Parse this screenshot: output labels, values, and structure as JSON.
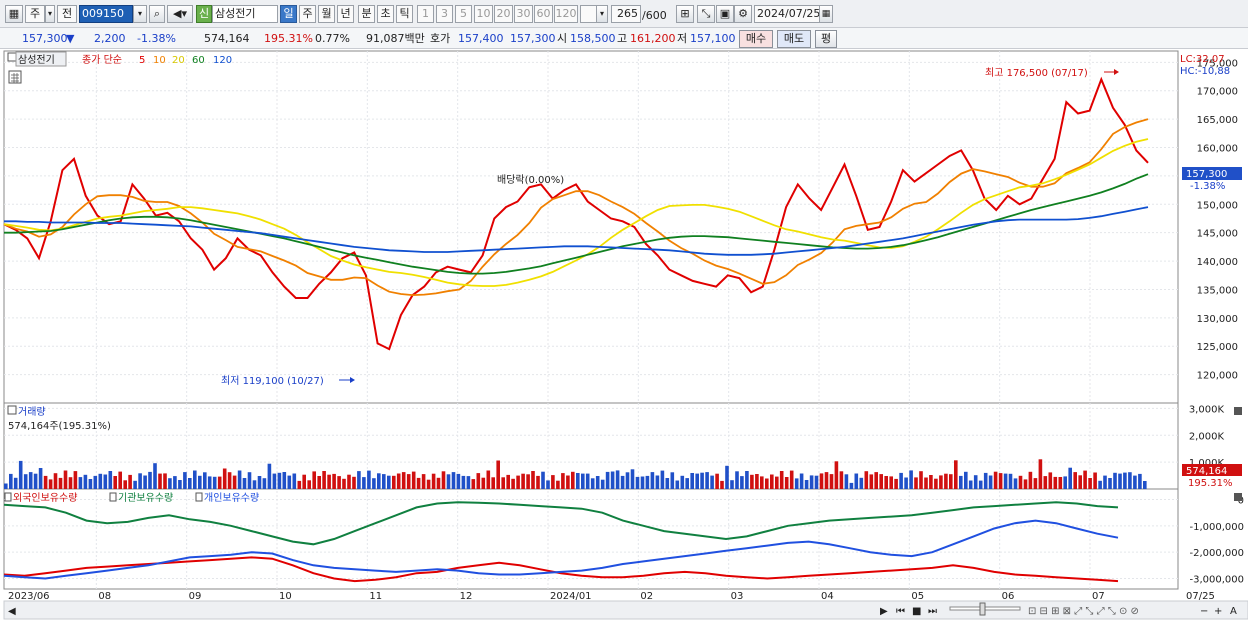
{
  "toolbar": {
    "period_label": "주",
    "prev_label": "전",
    "stock_code": "009150",
    "stock_name": "삼성전기",
    "sin_label": "신",
    "period_buttons": [
      "일",
      "주",
      "월",
      "년",
      "분",
      "초",
      "틱"
    ],
    "interval_buttons": [
      "1",
      "3",
      "5",
      "10",
      "20",
      "30",
      "60",
      "120"
    ],
    "count": "265",
    "count_max": "/600",
    "date": "2024/07/25"
  },
  "quote": {
    "price": "157,300",
    "change": "2,200",
    "change_pct": "-1.38%",
    "volume": "574,164",
    "volume_ratio": "195.31%",
    "turnover_pct": "0.77%",
    "amount": "91,087백만",
    "ask_label": "호가",
    "ask": "157,400",
    "bid": "157,300",
    "open_label": "시",
    "open": "158,500",
    "high_label": "고",
    "high": "161,200",
    "low_label": "저",
    "low": "157,100",
    "buy_label": "매수",
    "sell_label": "매도",
    "eval_label": "평"
  },
  "price_panel": {
    "name": "삼성전기",
    "ma_label": "종가 단순",
    "lc": "LC:32,07",
    "hc": "HC:-10,88",
    "high_annotation": "최고 176,500 (07/17)",
    "low_annotation": "최저 119,100 (10/27)",
    "dividend_annotation": "배당락(0.00%)",
    "current_price": "157,300",
    "current_pct": "-1.38%"
  },
  "volume_panel": {
    "title": "거래량",
    "readout": "574,164주(195.31%)",
    "current": "574,164",
    "current_pct": "195.31%"
  },
  "holdings_panel": {
    "series_labels": [
      "외국인보유수량",
      "기관보유수량",
      "개인보유수량"
    ]
  },
  "chart_data": [
    {
      "type": "candlestick",
      "y_axis_ticks": [
        "175,000",
        "170,000",
        "165,000",
        "160,000",
        "155,000",
        "150,000",
        "145,000",
        "140,000",
        "135,000",
        "130,000",
        "125,000",
        "120,000"
      ],
      "ylim": [
        115000,
        177000
      ],
      "moving_averages": [
        {
          "name": "5",
          "color": "#e00000"
        },
        {
          "name": "10",
          "color": "#f08000"
        },
        {
          "name": "20",
          "color": "#f0e000"
        },
        {
          "name": "60",
          "color": "#108020"
        },
        {
          "name": "120",
          "color": "#1050d0"
        }
      ],
      "series": [
        {
          "name": "5",
          "values": [
            146500,
            145500,
            144000,
            140500,
            147000,
            156000,
            158000,
            151500,
            148000,
            146500,
            147000,
            153500,
            151000,
            148000,
            148500,
            147000,
            144000,
            142000,
            138500,
            140500,
            144000,
            142000,
            141000,
            138000,
            135500,
            133500,
            133500,
            136000,
            138000,
            140500,
            141500,
            137500,
            125500,
            124500,
            130500,
            134000,
            135500,
            138000,
            139000,
            138500,
            138000,
            141000,
            147500,
            149500,
            150500,
            153000,
            153500,
            151000,
            152500,
            153500,
            150500,
            149000,
            147500,
            147000,
            146000,
            143000,
            141000,
            138500,
            137500,
            136500,
            136000,
            135500,
            137500,
            137000,
            134500,
            135500,
            142000,
            149500,
            153500,
            151000,
            149000,
            153000,
            157000,
            151500,
            145500,
            146000,
            150500,
            156000,
            154000,
            155500,
            157000,
            158500,
            159500,
            156000,
            151000,
            149000,
            151500,
            150000,
            151000,
            154500,
            158000,
            168000,
            166000,
            166500,
            172000,
            167000,
            164000,
            159500,
            157300
          ]
        },
        {
          "name": "10",
          "values": [
            146500,
            145700,
            145200,
            144300,
            144700,
            146000,
            148200,
            150000,
            151400,
            151600,
            151600,
            151300,
            150600,
            150400,
            150400,
            149700,
            148400,
            146800,
            144800,
            143700,
            142500,
            142100,
            141700,
            140900,
            140100,
            139200,
            137900,
            137300,
            136700,
            136700,
            137100,
            137000,
            135700,
            134600,
            134200,
            134000,
            134100,
            134300,
            134700,
            135000,
            136500,
            139000,
            141200,
            143000,
            144600,
            146700,
            149400,
            150900,
            151600,
            152300,
            152300,
            151600,
            150500,
            149500,
            148300,
            146700,
            145200,
            143600,
            142300,
            141300,
            140100,
            139200,
            138600,
            137800,
            136900,
            136000,
            136300,
            137500,
            139300,
            140300,
            141400,
            143300,
            145600,
            146200,
            146500,
            146800,
            147700,
            149200,
            150100,
            150400,
            151900,
            153900,
            155400,
            156200,
            155800,
            155300,
            154800,
            153800,
            153100,
            153100,
            153700,
            155500,
            156400,
            157400,
            159700,
            162400,
            163600,
            164400,
            165000
          ]
        },
        {
          "name": "20",
          "values": [
            146500,
            146200,
            145900,
            145500,
            145400,
            145700,
            146300,
            146900,
            147500,
            147800,
            148000,
            148400,
            148800,
            149000,
            149200,
            149500,
            149500,
            149300,
            149000,
            148700,
            148400,
            147900,
            147300,
            146500,
            145700,
            144600,
            143300,
            142100,
            140900,
            140100,
            139400,
            138900,
            138500,
            138100,
            137900,
            137600,
            137200,
            136700,
            136200,
            135900,
            135700,
            135600,
            135600,
            135800,
            136200,
            136700,
            137300,
            138100,
            139100,
            140100,
            141200,
            142500,
            144100,
            145500,
            146700,
            147900,
            149000,
            149700,
            149800,
            149900,
            149900,
            149600,
            149200,
            148700,
            147900,
            147100,
            146300,
            145600,
            145200,
            144700,
            144200,
            143800,
            143600,
            143200,
            142800,
            142400,
            142300,
            142600,
            143400,
            144300,
            145600,
            147000,
            148500,
            149900,
            150900,
            151600,
            152300,
            153000,
            153300,
            153700,
            154400,
            155200,
            156100,
            157000,
            158200,
            159400,
            160300,
            161000,
            161500
          ]
        },
        {
          "name": "60",
          "values": [
            145000,
            145000,
            145100,
            145200,
            145300,
            145600,
            146000,
            146400,
            146800,
            147200,
            147500,
            147700,
            147800,
            147800,
            147700,
            147500,
            147200,
            146800,
            146400,
            146000,
            145600,
            145200,
            144800,
            144400,
            144000,
            143500,
            143000,
            142500,
            142000,
            141500,
            141000,
            140600,
            140200,
            139800,
            139400,
            139000,
            138700,
            138400,
            138100,
            137900,
            137800,
            137800,
            137900,
            138100,
            138400,
            138700,
            139100,
            139600,
            140100,
            140600,
            141100,
            141600,
            142100,
            142600,
            143000,
            143400,
            143800,
            144100,
            144300,
            144400,
            144400,
            144300,
            144200,
            144000,
            143800,
            143600,
            143400,
            143200,
            143000,
            142800,
            142600,
            142400,
            142300,
            142200,
            142200,
            142300,
            142500,
            142800,
            143200,
            143700,
            144200,
            144800,
            145400,
            146000,
            146600,
            147200,
            147800,
            148400,
            149000,
            149500,
            150000,
            150500,
            151000,
            151500,
            152100,
            152800,
            153600,
            154500,
            155300
          ]
        },
        {
          "name": "120",
          "values": [
            147000,
            147000,
            146900,
            146900,
            146800,
            146800,
            146800,
            146800,
            146700,
            146700,
            146700,
            146600,
            146500,
            146400,
            146300,
            146200,
            146100,
            145900,
            145700,
            145500,
            145300,
            145100,
            144900,
            144600,
            144300,
            144000,
            143700,
            143400,
            143100,
            142800,
            142500,
            142300,
            142100,
            141900,
            141800,
            141700,
            141600,
            141600,
            141600,
            141700,
            141800,
            141900,
            142000,
            142100,
            142200,
            142300,
            142400,
            142500,
            142600,
            142600,
            142600,
            142500,
            142400,
            142300,
            142200,
            142100,
            142000,
            141900,
            141700,
            141500,
            141300,
            141200,
            141100,
            141100,
            141100,
            141200,
            141300,
            141500,
            141700,
            141900,
            142100,
            142300,
            142500,
            142800,
            143100,
            143400,
            143700,
            144000,
            144400,
            144800,
            145200,
            145600,
            146000,
            146400,
            146700,
            147000,
            147200,
            147300,
            147300,
            147300,
            147300,
            147300,
            147400,
            147600,
            147900,
            148300,
            148700,
            149100,
            149500
          ]
        }
      ]
    },
    {
      "type": "bar",
      "name": "거래량",
      "y_axis_ticks": [
        "3,000K",
        "2,000K",
        "1,000K"
      ],
      "ylim": [
        0,
        3200000
      ]
    },
    {
      "type": "line",
      "y_axis_ticks": [
        "0",
        "-1,000,000",
        "-2,000,000",
        "-3,000,000"
      ],
      "ylim": [
        -3400000,
        400000
      ],
      "x_labels": [
        "2023/06",
        "08",
        "09",
        "10",
        "11",
        "12",
        "2024/01",
        "02",
        "03",
        "04",
        "05",
        "06",
        "07",
        "07/25"
      ],
      "series": [
        {
          "name": "외국인보유수량",
          "color": "#e00000",
          "values": [
            -2850000,
            -2900000,
            -2800000,
            -2700000,
            -2600000,
            -2550000,
            -2500000,
            -2450000,
            -2400000,
            -2350000,
            -2300000,
            -2250000,
            -2200000,
            -2250000,
            -2500000,
            -2800000,
            -3000000,
            -3100000,
            -3050000,
            -2950000,
            -2800000,
            -2750000,
            -2600000,
            -2500000,
            -2400000,
            -2500000,
            -2650000,
            -2800000,
            -2900000,
            -2950000,
            -2950000,
            -2900000,
            -2800000,
            -2750000,
            -2800000,
            -2900000,
            -2950000,
            -3000000,
            -2950000,
            -2900000,
            -2850000,
            -2800000,
            -2750000,
            -2700000,
            -2650000,
            -2600000,
            -2500000,
            -2600000,
            -2750000,
            -2850000,
            -2900000,
            -2950000,
            -3000000,
            -3050000,
            -3100000
          ]
        },
        {
          "name": "기관보유수량",
          "color": "#108040",
          "values": [
            -200000,
            -250000,
            -300000,
            -500000,
            -800000,
            -900000,
            -850000,
            -700000,
            -600000,
            -750000,
            -850000,
            -1000000,
            -1200000,
            -1400000,
            -1600000,
            -1700000,
            -1500000,
            -1200000,
            -900000,
            -600000,
            -300000,
            -150000,
            -100000,
            -120000,
            -150000,
            -200000,
            -250000,
            -300000,
            -350000,
            -500000,
            -800000,
            -1000000,
            -1200000,
            -1300000,
            -1400000,
            -1500000,
            -1400000,
            -1200000,
            -1000000,
            -900000,
            -800000,
            -750000,
            -700000,
            -650000,
            -600000,
            -500000,
            -400000,
            -300000,
            -250000,
            -200000,
            -150000,
            -100000,
            -150000,
            -250000,
            -300000
          ]
        },
        {
          "name": "개인보유수량",
          "color": "#2050e0",
          "values": [
            -2900000,
            -2950000,
            -3000000,
            -2900000,
            -2800000,
            -2700000,
            -2600000,
            -2500000,
            -2350000,
            -2200000,
            -2150000,
            -2100000,
            -2000000,
            -2050000,
            -2300000,
            -2500000,
            -2600000,
            -2650000,
            -2700000,
            -2750000,
            -2700000,
            -2650000,
            -2700000,
            -2800000,
            -2850000,
            -2850000,
            -2800000,
            -2750000,
            -2700000,
            -2600000,
            -2450000,
            -2350000,
            -2250000,
            -2150000,
            -2050000,
            -1950000,
            -1850000,
            -1750000,
            -1650000,
            -1600000,
            -1700000,
            -1850000,
            -2000000,
            -2100000,
            -2150000,
            -2000000,
            -1700000,
            -1400000,
            -1100000,
            -900000,
            -800000,
            -900000,
            -1100000,
            -1300000,
            -1450000
          ]
        }
      ]
    }
  ]
}
